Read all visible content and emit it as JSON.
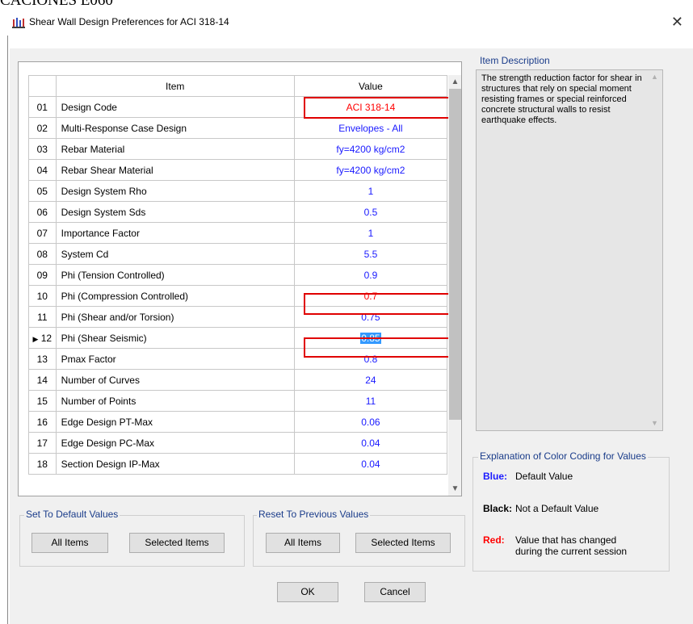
{
  "background_text": "CACIONES E060",
  "window": {
    "title": "Shear Wall Design Preferences for ACI 318-14",
    "close_icon": "close-icon"
  },
  "grid": {
    "headers": {
      "item": "Item",
      "value": "Value"
    },
    "rows": [
      {
        "num": "01",
        "item": "Design Code",
        "value": "ACI 318-14"
      },
      {
        "num": "02",
        "item": "Multi-Response Case Design",
        "value": "Envelopes - All"
      },
      {
        "num": "03",
        "item": "Rebar Material",
        "value": "fy=4200 kg/cm2"
      },
      {
        "num": "04",
        "item": "Rebar Shear Material",
        "value": "fy=4200 kg/cm2"
      },
      {
        "num": "05",
        "item": "Design System Rho",
        "value": "1"
      },
      {
        "num": "06",
        "item": "Design System Sds",
        "value": "0.5"
      },
      {
        "num": "07",
        "item": "Importance Factor",
        "value": "1"
      },
      {
        "num": "08",
        "item": "System Cd",
        "value": "5.5"
      },
      {
        "num": "09",
        "item": "Phi (Tension Controlled)",
        "value": "0.9"
      },
      {
        "num": "10",
        "item": "Phi (Compression Controlled)",
        "value": "0.7"
      },
      {
        "num": "11",
        "item": "Phi (Shear and/or Torsion)",
        "value": "0.75"
      },
      {
        "num": "12",
        "item": "Phi (Shear Seismic)",
        "value": "0.85"
      },
      {
        "num": "13",
        "item": "Pmax Factor",
        "value": "0.8"
      },
      {
        "num": "14",
        "item": "Number of Curves",
        "value": "24"
      },
      {
        "num": "15",
        "item": "Number of Points",
        "value": "11"
      },
      {
        "num": "16",
        "item": "Edge Design PT-Max",
        "value": "0.06"
      },
      {
        "num": "17",
        "item": "Edge Design PC-Max",
        "value": "0.04"
      },
      {
        "num": "18",
        "item": "Section Design IP-Max",
        "value": "0.04"
      }
    ],
    "current_row_marker": "▶",
    "colors": {
      "default_value": "#1a1aff",
      "changed_value": "#ff0000",
      "selection": "#3399ff",
      "highlight_box": "#e00000"
    }
  },
  "description": {
    "label": "Item Description",
    "text": "The strength reduction factor for shear in structures that rely on special moment resisting frames or special reinforced concrete structural walls to resist earthquake effects."
  },
  "color_coding": {
    "label": "Explanation of Color Coding for Values",
    "items": [
      {
        "key": "Blue:",
        "desc": "Default Value",
        "color": "#1a1aff"
      },
      {
        "key": "Black:",
        "desc": "Not a Default Value",
        "color": "#000000"
      },
      {
        "key": "Red:",
        "desc": "Value that has changed during the current session",
        "color": "#ff0000"
      }
    ]
  },
  "set_default": {
    "label": "Set To Default Values",
    "all": "All Items",
    "selected": "Selected Items"
  },
  "reset_previous": {
    "label": "Reset To Previous Values",
    "all": "All Items",
    "selected": "Selected Items"
  },
  "buttons": {
    "ok": "OK",
    "cancel": "Cancel"
  }
}
